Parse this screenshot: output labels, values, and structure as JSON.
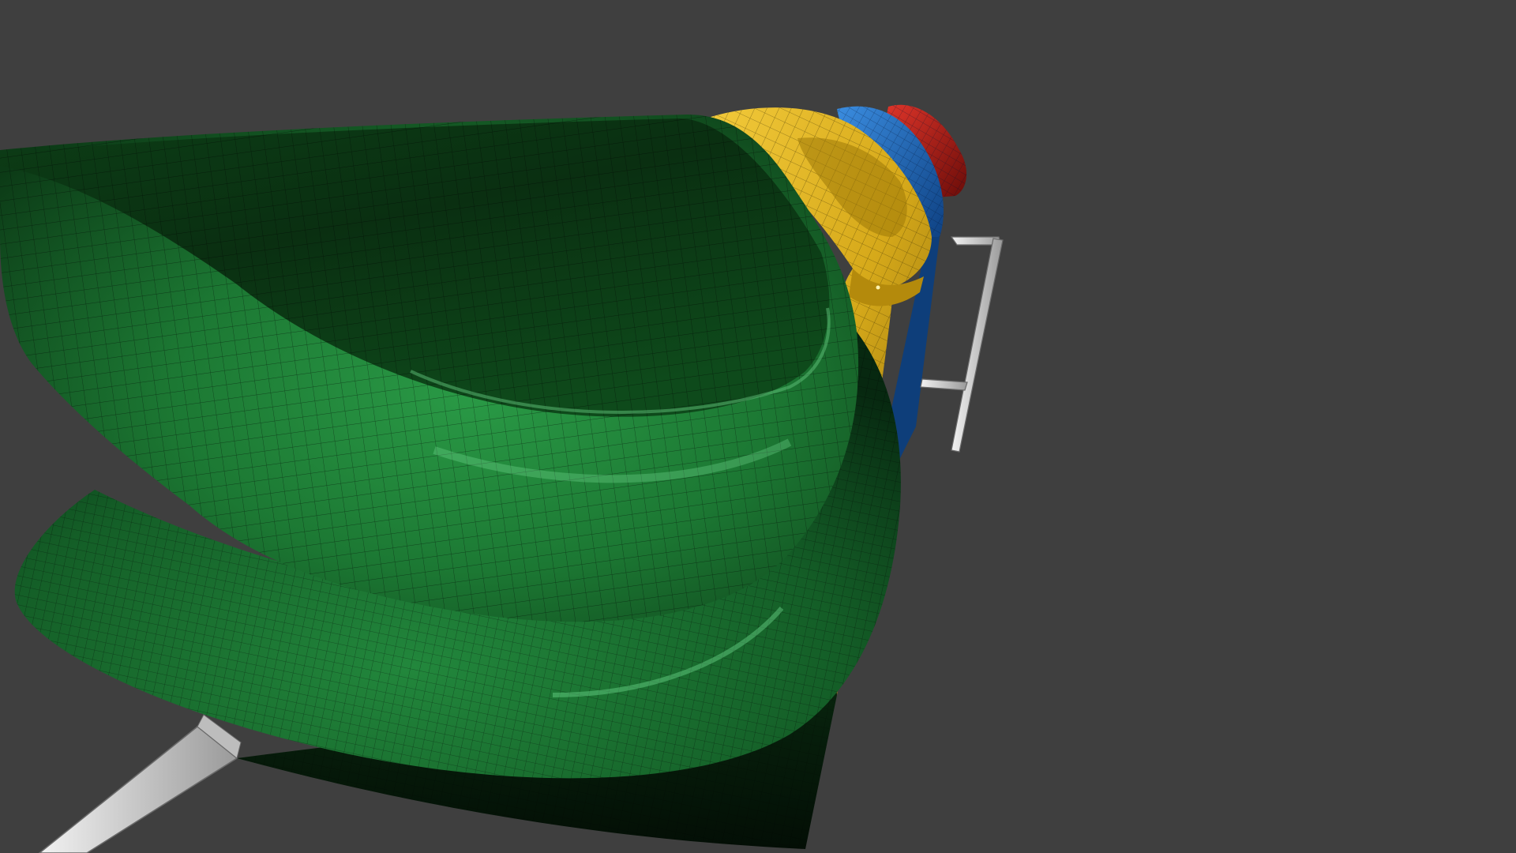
{
  "viewport": {
    "background_color": "#3f3f3f",
    "object_colors": {
      "green": "#1e7a34",
      "yellow": "#e0b21c",
      "blue": "#1f72c8",
      "red": "#c21b14",
      "rail": "#d7d7d7"
    },
    "display_mode": "shaded-with-wireframe"
  }
}
